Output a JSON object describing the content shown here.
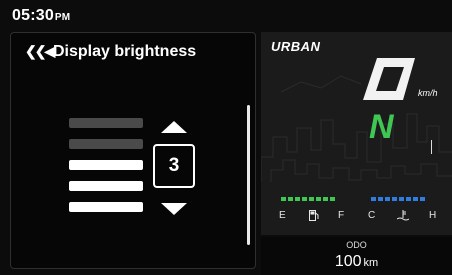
{
  "status_bar": {
    "time": "05:30",
    "ampm": "PM"
  },
  "brightness_panel": {
    "back_icon": "triple-chevron-left-icon",
    "title": "Display brightness",
    "value": "3",
    "level": 3,
    "max_level": 5,
    "increase_icon": "triangle-up-icon",
    "decrease_icon": "triangle-down-icon",
    "active_color": "#ffffff",
    "inactive_color": "#4a4a4a"
  },
  "cluster": {
    "ride_mode": "URBAN",
    "speed_unit": "km/h",
    "gear": "N",
    "gear_color": "#3fc653",
    "fuel": {
      "empty_label": "E",
      "full_label": "F",
      "icon": "fuel-pump-icon",
      "color": "#3fc653"
    },
    "temperature": {
      "cold_label": "C",
      "hot_label": "H",
      "icon": "coolant-temperature-icon",
      "color": "#2f7de1"
    }
  },
  "odometer": {
    "label": "ODO",
    "value": "100",
    "unit": "km"
  }
}
